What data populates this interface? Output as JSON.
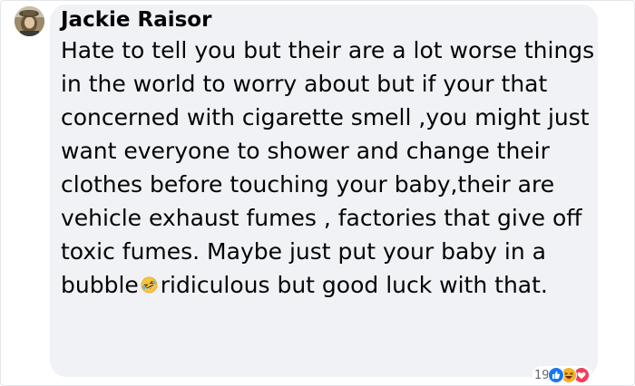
{
  "comment": {
    "author": "Jackie Raisor",
    "text_before_emoji": "Hate to tell you but their are a lot worse things in the world to worry about but if your that concerned with cigarette smell ,you might just want everyone to shower and change their clothes before touching your baby,their are vehicle exhaust fumes , factories that give off toxic fumes. Maybe just put your baby in a bubble",
    "emoji": "rolling-on-floor-laughing-emoji",
    "text_after_emoji": "ridiculous but good luck with that.",
    "reactions": {
      "count": "19",
      "icons": [
        "like-icon",
        "haha-icon",
        "love-icon"
      ]
    }
  },
  "colors": {
    "bubble": "#f0f2f5",
    "text": "#050505",
    "like": "#1877f2",
    "haha": "#f7b125",
    "love": "#f33e58",
    "muted": "#65676b"
  }
}
